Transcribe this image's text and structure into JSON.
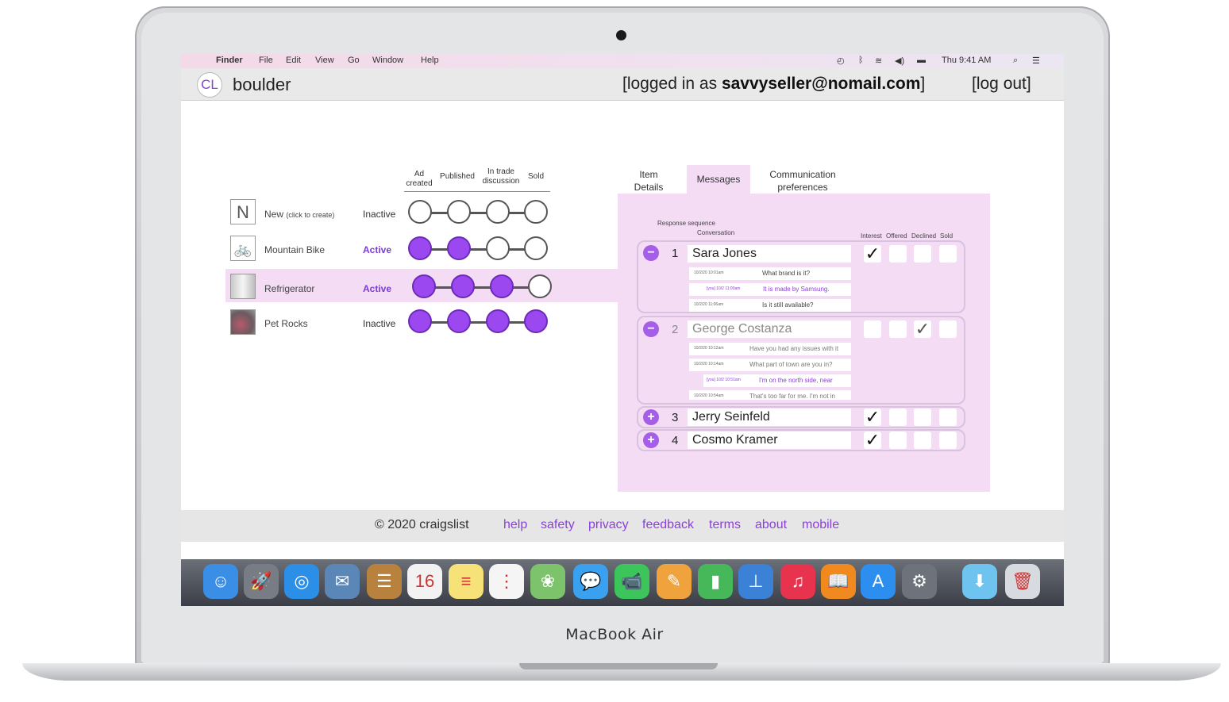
{
  "device": {
    "brand": "MacBook Air"
  },
  "menubar": {
    "apple": "",
    "app": "Finder",
    "menus": [
      "File",
      "Edit",
      "View",
      "Go",
      "Window",
      "Help"
    ],
    "time": "Thu 9:41 AM",
    "status_icons": [
      "time-machine-icon",
      "bluetooth-icon",
      "wifi-icon",
      "volume-icon",
      "battery-icon",
      "spotlight-icon",
      "notification-icon"
    ]
  },
  "header": {
    "logo": "CL",
    "city": "boulder",
    "login_prefix": "[logged in as ",
    "login_email": "savvyseller@nomail.com",
    "login_suffix": "]",
    "logout": "[log out]"
  },
  "listings": {
    "steps": [
      "Ad created",
      "Published",
      "In trade discussion",
      "Sold"
    ],
    "items": [
      {
        "thumb": "N",
        "name": "New",
        "name_suffix": "(click to create)",
        "status": "Inactive",
        "progress": 0
      },
      {
        "thumb": "bicycle-icon",
        "name": "Mountain Bike",
        "name_suffix": "",
        "status": "Active",
        "progress": 2
      },
      {
        "thumb": "refrigerator-icon",
        "name": "Refrigerator",
        "name_suffix": "",
        "status": "Active",
        "progress": 3
      },
      {
        "thumb": "pet-rocks-image",
        "name": "Pet Rocks",
        "name_suffix": "",
        "status": "Inactive",
        "progress": 4
      }
    ]
  },
  "detail": {
    "tabs": [
      "Item Details",
      "Messages",
      "Communication preferences"
    ],
    "active_tab": "Messages",
    "columns": {
      "sequence": "Response sequence",
      "conversation": "Conversation",
      "interest": "Interest",
      "offered": "Offered",
      "declined": "Declined",
      "sold": "Sold"
    },
    "conversations": [
      {
        "seq": "1",
        "name": "Sara Jones",
        "toggle": "−",
        "expanded": true,
        "checks": [
          "✓",
          "",
          "",
          ""
        ],
        "messages": [
          {
            "ts": "10/2/20 10:01am",
            "text": "What brand is it?",
            "reply": false
          },
          {
            "ts": "[you] 10/2 11:00am",
            "text": "It is made by Samsung.",
            "reply": true
          },
          {
            "ts": "10/2/20 11:06am",
            "text": "Is it still available?",
            "reply": false
          }
        ]
      },
      {
        "seq": "2",
        "name": "George Costanza",
        "toggle": "−",
        "expanded": true,
        "checks": [
          "",
          "",
          "✓",
          ""
        ],
        "messages": [
          {
            "ts": "10/2/20 10:12am",
            "text": "Have you had any issues with it",
            "reply": false
          },
          {
            "ts": "10/2/20 10:14am",
            "text": "What part of town are you in?",
            "reply": false
          },
          {
            "ts": "[you] 10/2 10:51am",
            "text": "I'm on the north side, near",
            "reply": true
          },
          {
            "ts": "10/2/20 10:54am",
            "text": "That's too far for me. I'm not in",
            "reply": false
          }
        ]
      },
      {
        "seq": "3",
        "name": "Jerry Seinfeld",
        "toggle": "+",
        "expanded": false,
        "checks": [
          "✓",
          "",
          "",
          ""
        ],
        "messages": []
      },
      {
        "seq": "4",
        "name": "Cosmo Kramer",
        "toggle": "+",
        "expanded": false,
        "checks": [
          "✓",
          "",
          "",
          ""
        ],
        "messages": []
      }
    ]
  },
  "footer": {
    "copyright": "© 2020 craigslist",
    "links": [
      "help",
      "safety",
      "privacy",
      "feedback",
      "terms",
      "about",
      "mobile"
    ]
  },
  "dock": {
    "apps": [
      {
        "name": "finder-icon",
        "glyph": "☺",
        "color": "#3a8ee6"
      },
      {
        "name": "launchpad-icon",
        "glyph": "🚀",
        "color": "#777c85"
      },
      {
        "name": "safari-icon",
        "glyph": "◎",
        "color": "#2b8fe8"
      },
      {
        "name": "mail-icon",
        "glyph": "✉",
        "color": "#5b86b8"
      },
      {
        "name": "contacts-icon",
        "glyph": "☰",
        "color": "#b8823e"
      },
      {
        "name": "calendar-icon",
        "glyph": "16",
        "color": "#f2f2f2"
      },
      {
        "name": "notes-icon",
        "glyph": "≡",
        "color": "#f7e27a"
      },
      {
        "name": "reminders-icon",
        "glyph": "⋮",
        "color": "#f5f5f5"
      },
      {
        "name": "photos-icon",
        "glyph": "❀",
        "color": "#7cc36b"
      },
      {
        "name": "messages-icon",
        "glyph": "💬",
        "color": "#3aa0f0"
      },
      {
        "name": "facetime-icon",
        "glyph": "📹",
        "color": "#3cc55a"
      },
      {
        "name": "pages-icon",
        "glyph": "✎",
        "color": "#f0a23c"
      },
      {
        "name": "numbers-icon",
        "glyph": "▮",
        "color": "#46b85a"
      },
      {
        "name": "keynote-icon",
        "glyph": "⊥",
        "color": "#3b82d6"
      },
      {
        "name": "itunes-icon",
        "glyph": "♫",
        "color": "#e8334f"
      },
      {
        "name": "ibooks-icon",
        "glyph": "📖",
        "color": "#f08a1e"
      },
      {
        "name": "app-store-icon",
        "glyph": "A",
        "color": "#2c8ff0"
      },
      {
        "name": "system-preferences-icon",
        "glyph": "⚙",
        "color": "#6e737b"
      },
      {
        "name": "downloads-folder-icon",
        "glyph": "⬇",
        "color": "#6fc3ef"
      },
      {
        "name": "trash-icon",
        "glyph": "🗑",
        "color": "#d7dade"
      }
    ]
  }
}
